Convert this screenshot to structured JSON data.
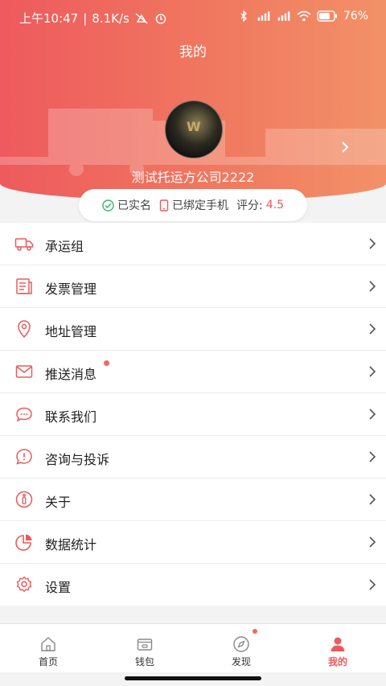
{
  "status_bar": {
    "time": "上午10:47",
    "speed": "8.1K/s",
    "battery": "76%"
  },
  "header": {
    "title": "我的",
    "company_name": "测试托运方公司2222",
    "avatar_mark": "W"
  },
  "badges": {
    "verified": "已实名",
    "phone": "已绑定手机",
    "score_label": "评分:",
    "score_value": "4.5"
  },
  "menu": [
    {
      "label": "承运组",
      "icon": "truck-icon"
    },
    {
      "label": "发票管理",
      "icon": "invoice-icon"
    },
    {
      "label": "地址管理",
      "icon": "location-icon",
      "has_dot": false
    },
    {
      "label": "推送消息",
      "icon": "mail-icon",
      "has_dot": true
    },
    {
      "label": "联系我们",
      "icon": "chat-icon"
    },
    {
      "label": "咨询与投诉",
      "icon": "alert-icon"
    },
    {
      "label": "关于",
      "icon": "info-icon"
    },
    {
      "label": "数据统计",
      "icon": "pie-chart-icon"
    },
    {
      "label": "设置",
      "icon": "gear-icon"
    }
  ],
  "bottom_nav": [
    {
      "label": "首页",
      "icon": "home-icon",
      "active": false
    },
    {
      "label": "钱包",
      "icon": "wallet-icon",
      "active": false
    },
    {
      "label": "发现",
      "icon": "compass-icon",
      "active": false,
      "has_dot": true
    },
    {
      "label": "我的",
      "icon": "user-icon",
      "active": true
    }
  ],
  "colors": {
    "accent": "#ec5a5c",
    "header_start": "#ee5a5e",
    "header_end": "#f29168"
  }
}
